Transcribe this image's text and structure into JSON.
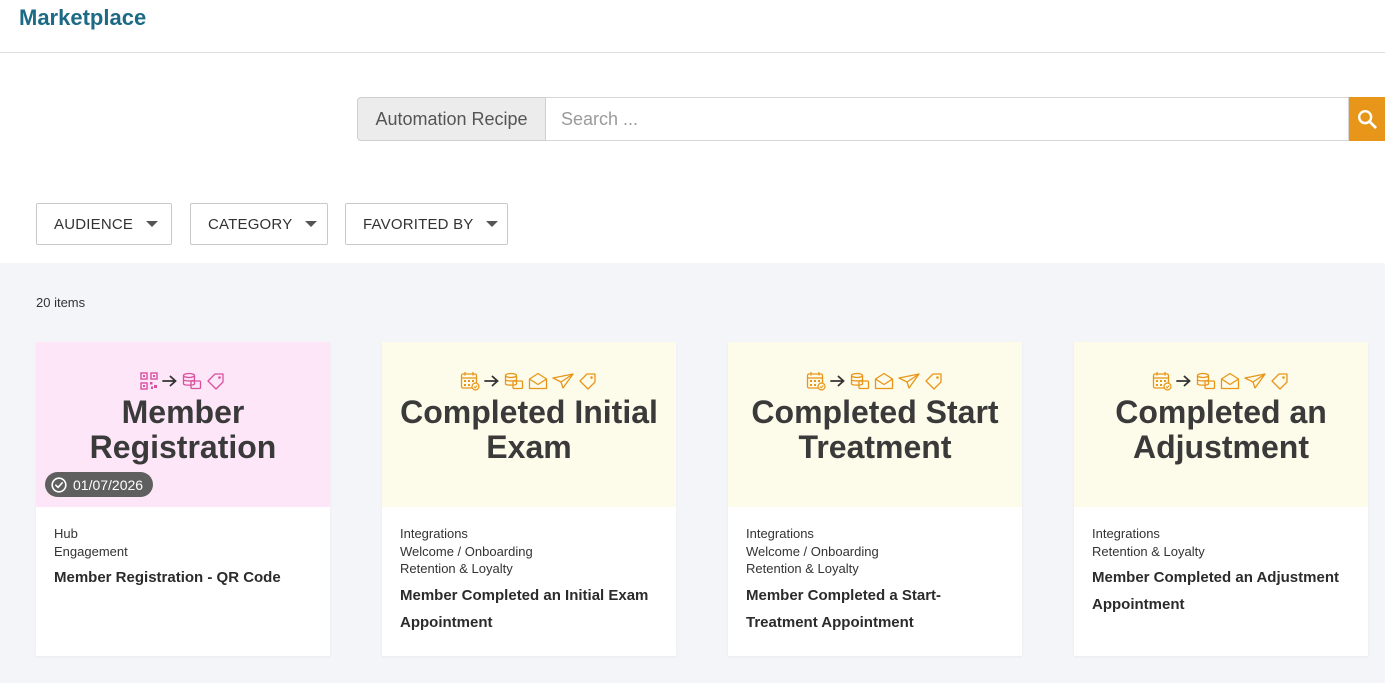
{
  "header": {
    "title": "Marketplace"
  },
  "search": {
    "scope_label": "Automation Recipe",
    "placeholder": "Search ...",
    "value": ""
  },
  "filters": [
    {
      "label": "AUDIENCE"
    },
    {
      "label": "CATEGORY"
    },
    {
      "label": "FAVORITED BY"
    }
  ],
  "results": {
    "count_text": "20 items",
    "cards": [
      {
        "banner_color": "#fde6f7",
        "icon_color": "#d9509f",
        "banner_title": "Member Registration",
        "badge_date": "01/07/2026",
        "tags": [
          "Hub",
          "Engagement"
        ],
        "name": "Member Registration - QR Code"
      },
      {
        "banner_color": "#fdfbe9",
        "icon_color": "#e8961a",
        "banner_title": "Completed Initial Exam",
        "tags": [
          "Integrations",
          "Welcome / Onboarding",
          "Retention & Loyalty"
        ],
        "name": "Member Completed an Initial Exam Appointment"
      },
      {
        "banner_color": "#fdfbe9",
        "icon_color": "#e8961a",
        "banner_title": "Completed Start Treatment",
        "tags": [
          "Integrations",
          "Welcome / Onboarding",
          "Retention & Loyalty"
        ],
        "name": "Member Completed a Start-Treatment Appointment"
      },
      {
        "banner_color": "#fdfbe9",
        "icon_color": "#e8961a",
        "banner_title": "Completed an Adjustment",
        "tags": [
          "Integrations",
          "Retention & Loyalty"
        ],
        "name": "Member Completed an Adjustment Appointment"
      }
    ]
  }
}
